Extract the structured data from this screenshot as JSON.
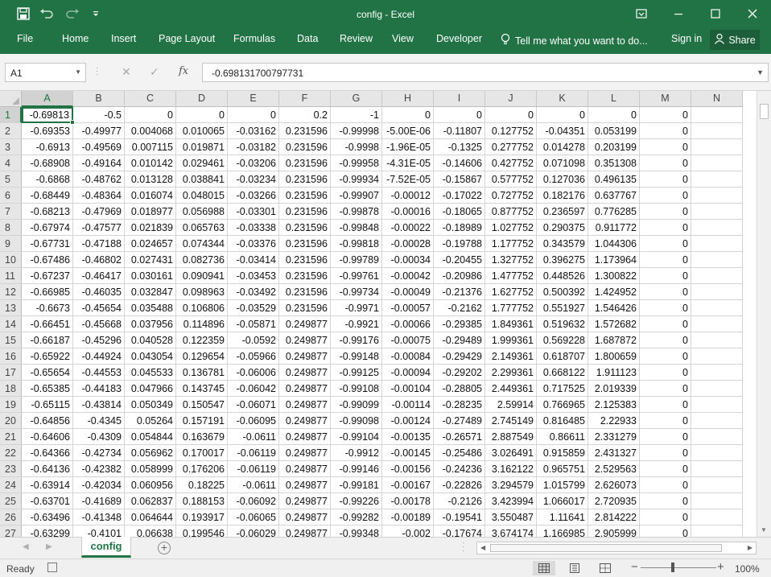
{
  "window": {
    "title": "config - Excel",
    "accent": "#217346"
  },
  "quick_access": [
    "save-icon",
    "undo-icon",
    "redo-icon",
    "customize-icon"
  ],
  "ribbon": {
    "tabs": [
      "File",
      "Home",
      "Insert",
      "Page Layout",
      "Formulas",
      "Data",
      "Review",
      "View",
      "Developer"
    ],
    "tell_me": "Tell me what you want to do...",
    "sign_in": "Sign in",
    "share": "Share"
  },
  "formula_bar": {
    "name_box": "A1",
    "formula": "-0.698131700797731"
  },
  "grid": {
    "columns": [
      "A",
      "B",
      "C",
      "D",
      "E",
      "F",
      "G",
      "H",
      "I",
      "J",
      "K",
      "L",
      "M",
      "N"
    ],
    "active_cell": "A1",
    "rows": [
      {
        "n": "1",
        "cells": [
          "-0.69813",
          "-0.5",
          "0",
          "0",
          "0",
          "0.2",
          "-1",
          "0",
          "0",
          "0",
          "0",
          "0",
          "0",
          ""
        ]
      },
      {
        "n": "2",
        "cells": [
          "-0.69353",
          "-0.49977",
          "0.004068",
          "0.010065",
          "-0.03162",
          "0.231596",
          "-0.99998",
          "-5.00E-06",
          "-0.11807",
          "0.127752",
          "-0.04351",
          "0.053199",
          "0",
          ""
        ]
      },
      {
        "n": "3",
        "cells": [
          "-0.6913",
          "-0.49569",
          "0.007115",
          "0.019871",
          "-0.03182",
          "0.231596",
          "-0.9998",
          "-1.96E-05",
          "-0.1325",
          "0.277752",
          "0.014278",
          "0.203199",
          "0",
          ""
        ]
      },
      {
        "n": "4",
        "cells": [
          "-0.68908",
          "-0.49164",
          "0.010142",
          "0.029461",
          "-0.03206",
          "0.231596",
          "-0.99958",
          "-4.31E-05",
          "-0.14606",
          "0.427752",
          "0.071098",
          "0.351308",
          "0",
          ""
        ]
      },
      {
        "n": "5",
        "cells": [
          "-0.6868",
          "-0.48762",
          "0.013128",
          "0.038841",
          "-0.03234",
          "0.231596",
          "-0.99934",
          "-7.52E-05",
          "-0.15867",
          "0.577752",
          "0.127036",
          "0.496135",
          "0",
          ""
        ]
      },
      {
        "n": "6",
        "cells": [
          "-0.68449",
          "-0.48364",
          "0.016074",
          "0.048015",
          "-0.03266",
          "0.231596",
          "-0.99907",
          "-0.00012",
          "-0.17022",
          "0.727752",
          "0.182176",
          "0.637767",
          "0",
          ""
        ]
      },
      {
        "n": "7",
        "cells": [
          "-0.68213",
          "-0.47969",
          "0.018977",
          "0.056988",
          "-0.03301",
          "0.231596",
          "-0.99878",
          "-0.00016",
          "-0.18065",
          "0.877752",
          "0.236597",
          "0.776285",
          "0",
          ""
        ]
      },
      {
        "n": "8",
        "cells": [
          "-0.67974",
          "-0.47577",
          "0.021839",
          "0.065763",
          "-0.03338",
          "0.231596",
          "-0.99848",
          "-0.00022",
          "-0.18989",
          "1.027752",
          "0.290375",
          "0.911772",
          "0",
          ""
        ]
      },
      {
        "n": "9",
        "cells": [
          "-0.67731",
          "-0.47188",
          "0.024657",
          "0.074344",
          "-0.03376",
          "0.231596",
          "-0.99818",
          "-0.00028",
          "-0.19788",
          "1.177752",
          "0.343579",
          "1.044306",
          "0",
          ""
        ]
      },
      {
        "n": "10",
        "cells": [
          "-0.67486",
          "-0.46802",
          "0.027431",
          "0.082736",
          "-0.03414",
          "0.231596",
          "-0.99789",
          "-0.00034",
          "-0.20455",
          "1.327752",
          "0.396275",
          "1.173964",
          "0",
          ""
        ]
      },
      {
        "n": "11",
        "cells": [
          "-0.67237",
          "-0.46417",
          "0.030161",
          "0.090941",
          "-0.03453",
          "0.231596",
          "-0.99761",
          "-0.00042",
          "-0.20986",
          "1.477752",
          "0.448526",
          "1.300822",
          "0",
          ""
        ]
      },
      {
        "n": "12",
        "cells": [
          "-0.66985",
          "-0.46035",
          "0.032847",
          "0.098963",
          "-0.03492",
          "0.231596",
          "-0.99734",
          "-0.00049",
          "-0.21376",
          "1.627752",
          "0.500392",
          "1.424952",
          "0",
          ""
        ]
      },
      {
        "n": "13",
        "cells": [
          "-0.6673",
          "-0.45654",
          "0.035488",
          "0.106806",
          "-0.03529",
          "0.231596",
          "-0.9971",
          "-0.00057",
          "-0.2162",
          "1.777752",
          "0.551927",
          "1.546426",
          "0",
          ""
        ]
      },
      {
        "n": "14",
        "cells": [
          "-0.66451",
          "-0.45668",
          "0.037956",
          "0.114896",
          "-0.05871",
          "0.249877",
          "-0.9921",
          "-0.00066",
          "-0.29385",
          "1.849361",
          "0.519632",
          "1.572682",
          "0",
          ""
        ]
      },
      {
        "n": "15",
        "cells": [
          "-0.66187",
          "-0.45296",
          "0.040528",
          "0.122359",
          "-0.0592",
          "0.249877",
          "-0.99176",
          "-0.00075",
          "-0.29489",
          "1.999361",
          "0.569228",
          "1.687872",
          "0",
          ""
        ]
      },
      {
        "n": "16",
        "cells": [
          "-0.65922",
          "-0.44924",
          "0.043054",
          "0.129654",
          "-0.05966",
          "0.249877",
          "-0.99148",
          "-0.00084",
          "-0.29429",
          "2.149361",
          "0.618707",
          "1.800659",
          "0",
          ""
        ]
      },
      {
        "n": "17",
        "cells": [
          "-0.65654",
          "-0.44553",
          "0.045533",
          "0.136781",
          "-0.06006",
          "0.249877",
          "-0.99125",
          "-0.00094",
          "-0.29202",
          "2.299361",
          "0.668122",
          "1.911123",
          "0",
          ""
        ]
      },
      {
        "n": "18",
        "cells": [
          "-0.65385",
          "-0.44183",
          "0.047966",
          "0.143745",
          "-0.06042",
          "0.249877",
          "-0.99108",
          "-0.00104",
          "-0.28805",
          "2.449361",
          "0.717525",
          "2.019339",
          "0",
          ""
        ]
      },
      {
        "n": "19",
        "cells": [
          "-0.65115",
          "-0.43814",
          "0.050349",
          "0.150547",
          "-0.06071",
          "0.249877",
          "-0.99099",
          "-0.00114",
          "-0.28235",
          "2.59914",
          "0.766965",
          "2.125383",
          "0",
          ""
        ]
      },
      {
        "n": "20",
        "cells": [
          "-0.64856",
          "-0.4345",
          "0.05264",
          "0.157191",
          "-0.06095",
          "0.249877",
          "-0.99098",
          "-0.00124",
          "-0.27489",
          "2.745149",
          "0.816485",
          "2.22933",
          "0",
          ""
        ]
      },
      {
        "n": "21",
        "cells": [
          "-0.64606",
          "-0.4309",
          "0.054844",
          "0.163679",
          "-0.0611",
          "0.249877",
          "-0.99104",
          "-0.00135",
          "-0.26571",
          "2.887549",
          "0.86611",
          "2.331279",
          "0",
          ""
        ]
      },
      {
        "n": "22",
        "cells": [
          "-0.64366",
          "-0.42734",
          "0.056962",
          "0.170017",
          "-0.06119",
          "0.249877",
          "-0.9912",
          "-0.00145",
          "-0.25486",
          "3.026491",
          "0.915859",
          "2.431327",
          "0",
          ""
        ]
      },
      {
        "n": "23",
        "cells": [
          "-0.64136",
          "-0.42382",
          "0.058999",
          "0.176206",
          "-0.06119",
          "0.249877",
          "-0.99146",
          "-0.00156",
          "-0.24236",
          "3.162122",
          "0.965751",
          "2.529563",
          "0",
          ""
        ]
      },
      {
        "n": "24",
        "cells": [
          "-0.63914",
          "-0.42034",
          "0.060956",
          "0.18225",
          "-0.0611",
          "0.249877",
          "-0.99181",
          "-0.00167",
          "-0.22826",
          "3.294579",
          "1.015799",
          "2.626073",
          "0",
          ""
        ]
      },
      {
        "n": "25",
        "cells": [
          "-0.63701",
          "-0.41689",
          "0.062837",
          "0.188153",
          "-0.06092",
          "0.249877",
          "-0.99226",
          "-0.00178",
          "-0.2126",
          "3.423994",
          "1.066017",
          "2.720935",
          "0",
          ""
        ]
      },
      {
        "n": "26",
        "cells": [
          "-0.63496",
          "-0.41348",
          "0.064644",
          "0.193917",
          "-0.06065",
          "0.249877",
          "-0.99282",
          "-0.00189",
          "-0.19541",
          "3.550487",
          "1.11641",
          "2.814222",
          "0",
          ""
        ]
      },
      {
        "n": "27",
        "cells": [
          "-0.63299",
          "-0.4101",
          "0.06638",
          "0.199546",
          "-0.06029",
          "0.249877",
          "-0.99348",
          "-0.002",
          "-0.17674",
          "3.674174",
          "1.166985",
          "2.905999",
          "0",
          ""
        ]
      }
    ]
  },
  "sheets": {
    "tabs": [
      "config"
    ],
    "active": "config"
  },
  "status_bar": {
    "ready": "Ready",
    "zoom": "100%"
  }
}
